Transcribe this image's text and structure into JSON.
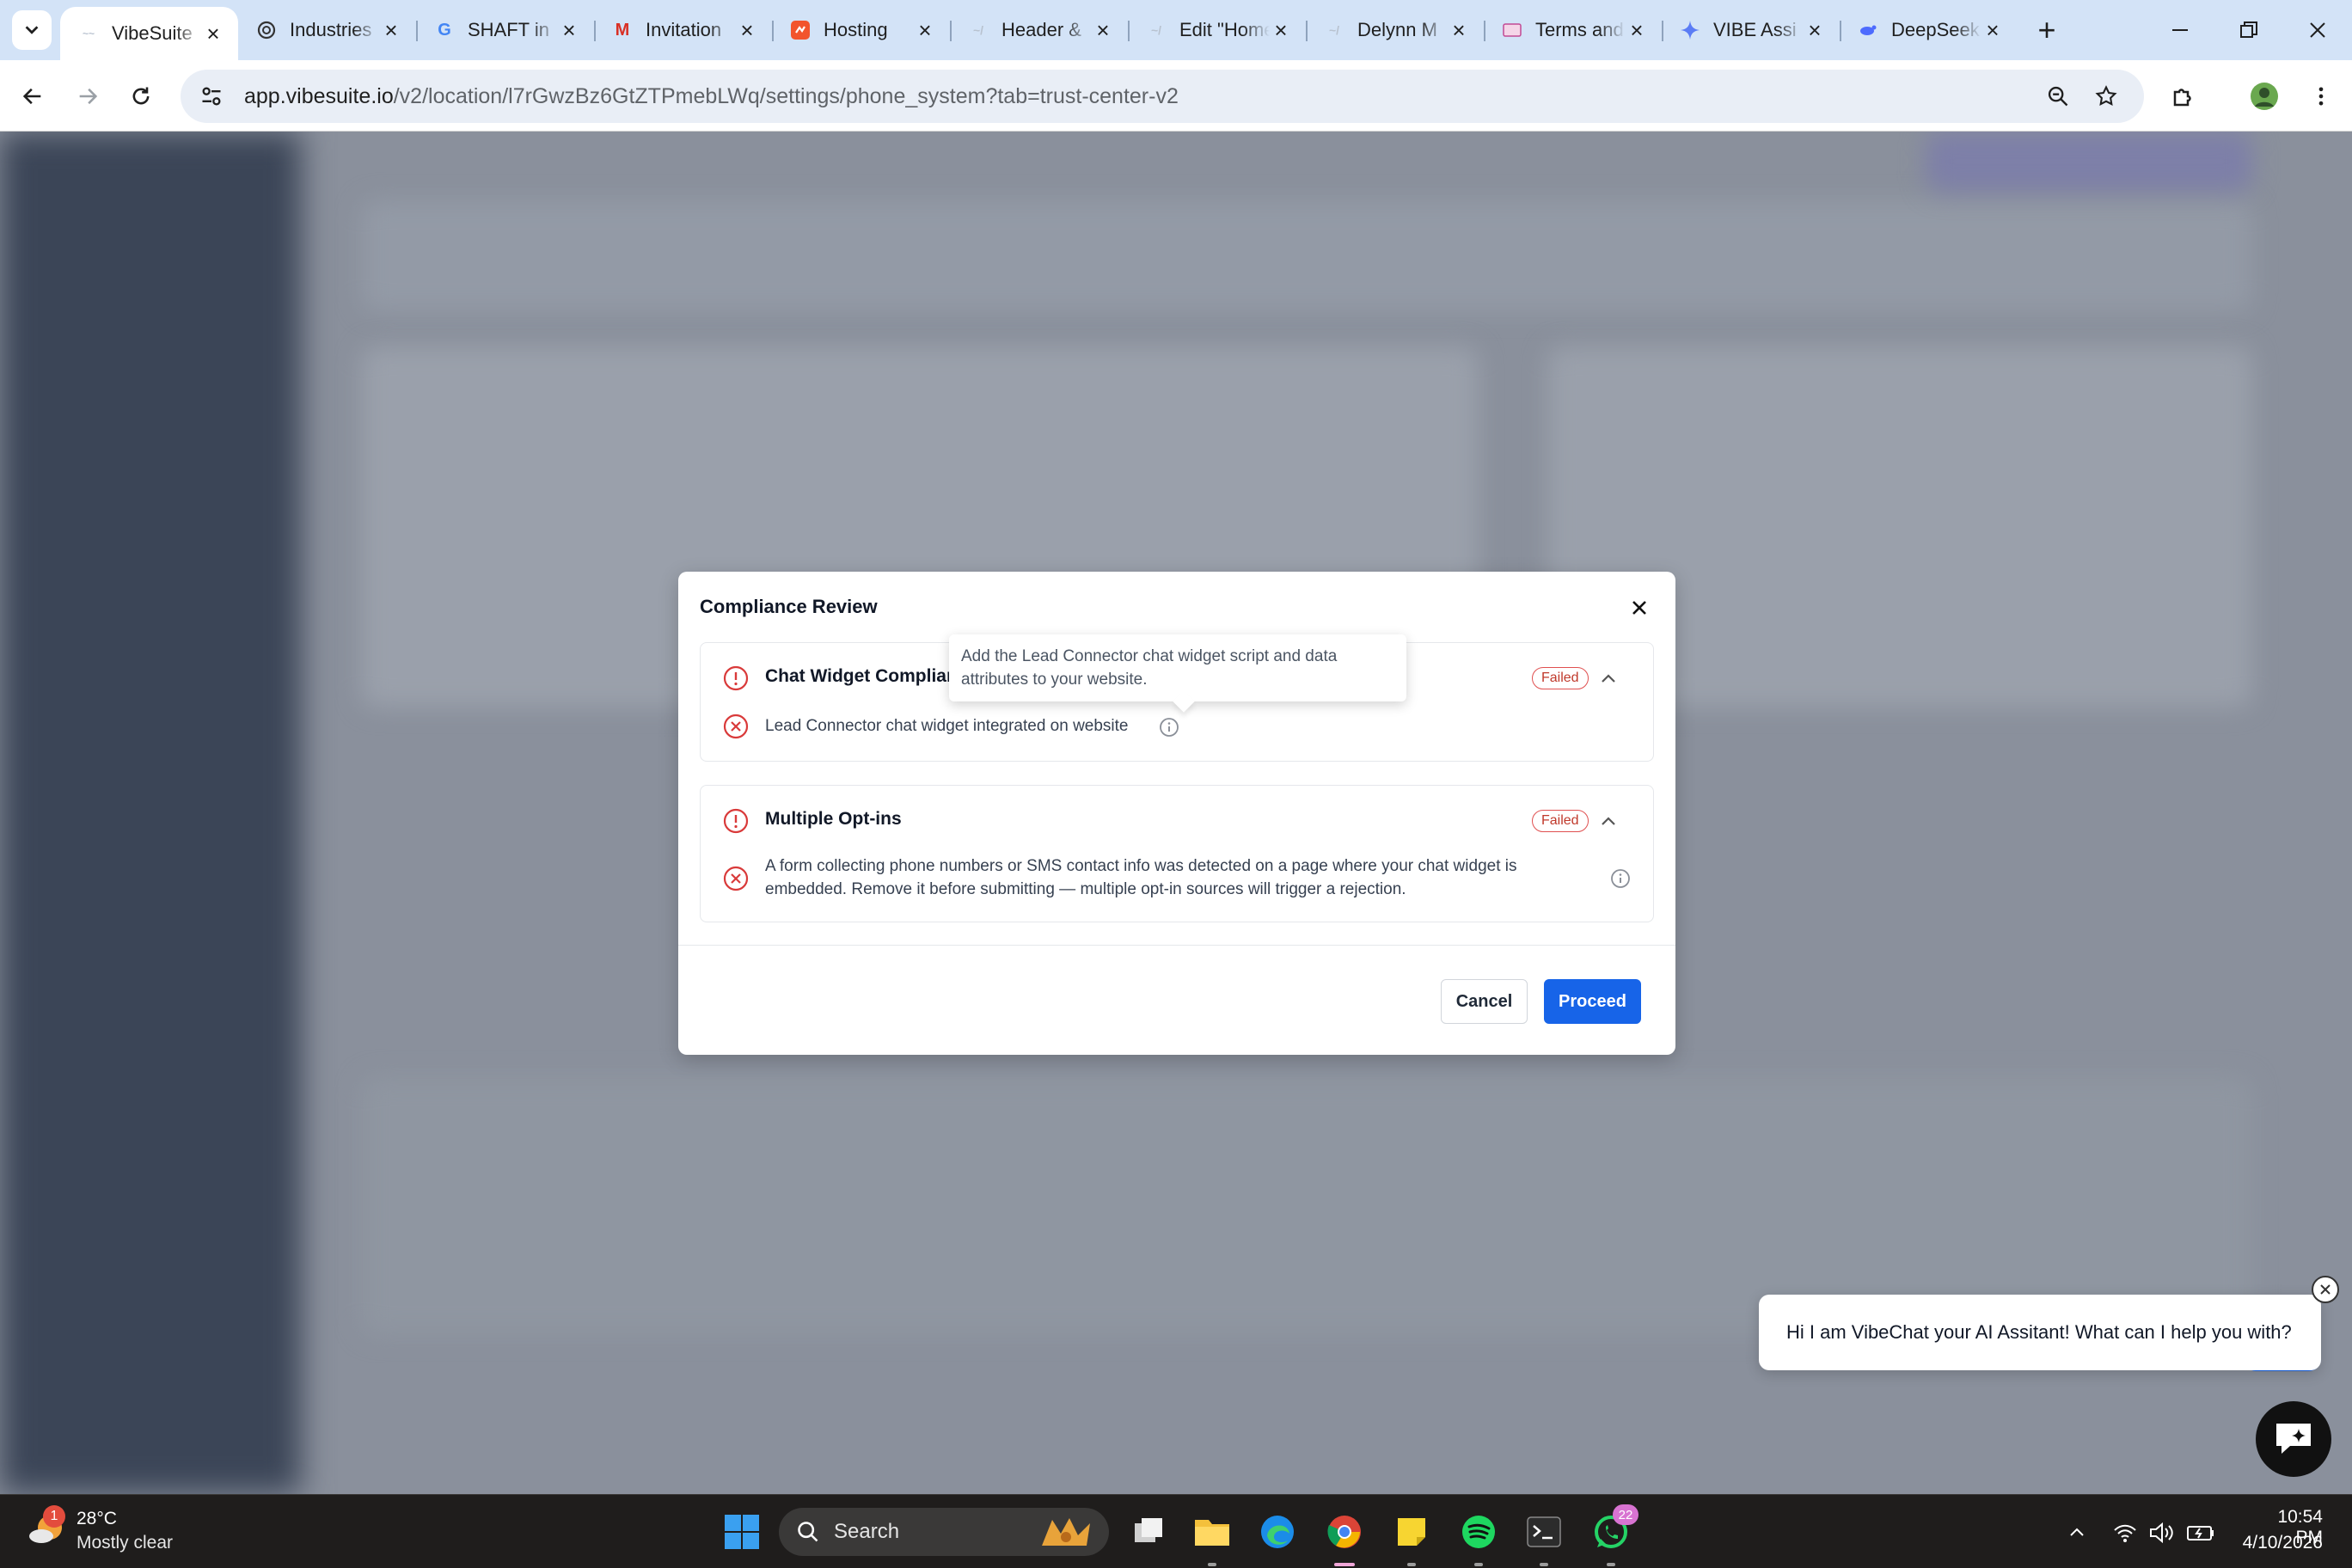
{
  "browser": {
    "tabs": [
      {
        "title": "VibeSuite",
        "active": true
      },
      {
        "title": "Industries"
      },
      {
        "title": "SHAFT in"
      },
      {
        "title": "Invitation"
      },
      {
        "title": "Hosting"
      },
      {
        "title": "Header &"
      },
      {
        "title": "Edit \"Home"
      },
      {
        "title": "Delynn M"
      },
      {
        "title": "Terms and"
      },
      {
        "title": "VIBE Assi"
      },
      {
        "title": "DeepSeek"
      }
    ],
    "url_host": "app.vibesuite.io",
    "url_path": "/v2/location/l7rGwzBz6GtZTPmebLWq/settings/phone_system?tab=trust-center-v2"
  },
  "modal": {
    "title": "Compliance Review",
    "sections": [
      {
        "title": "Chat Widget Compliance",
        "status": "Failed",
        "item": "Lead Connector chat widget integrated on website"
      },
      {
        "title": "Multiple Opt-ins",
        "status": "Failed",
        "item_line1": "A form collecting phone numbers or SMS contact info was detected on a page where your chat widget is",
        "item_line2": "embedded. Remove it before submitting — multiple opt-in sources will trigger a rejection."
      }
    ],
    "tooltip_line1": "Add the Lead Connector chat widget script and data",
    "tooltip_line2": "attributes to your website.",
    "cancel_label": "Cancel",
    "proceed_label": "Proceed"
  },
  "chat_widget": {
    "message": "Hi I am VibeChat your AI Assitant! What can I help you with?"
  },
  "taskbar": {
    "weather_badge": "1",
    "temperature": "28°C",
    "weather": "Mostly clear",
    "search_label": "Search",
    "whatsapp_badge": "22",
    "time": "10:54 PM",
    "date": "4/10/2026"
  },
  "colors": {
    "primary": "#1764e8",
    "failed": "#c0392b",
    "tabstrip": "#d3e3f7"
  }
}
